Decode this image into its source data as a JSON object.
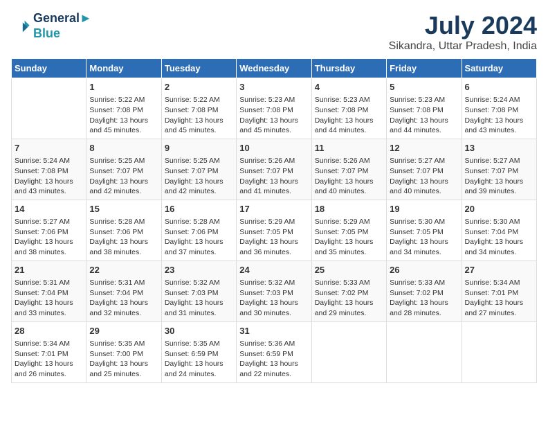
{
  "header": {
    "logo_line1": "General",
    "logo_line2": "Blue",
    "title": "July 2024",
    "subtitle": "Sikandra, Uttar Pradesh, India"
  },
  "weekdays": [
    "Sunday",
    "Monday",
    "Tuesday",
    "Wednesday",
    "Thursday",
    "Friday",
    "Saturday"
  ],
  "weeks": [
    [
      {
        "day": "",
        "content": ""
      },
      {
        "day": "1",
        "content": "Sunrise: 5:22 AM\nSunset: 7:08 PM\nDaylight: 13 hours\nand 45 minutes."
      },
      {
        "day": "2",
        "content": "Sunrise: 5:22 AM\nSunset: 7:08 PM\nDaylight: 13 hours\nand 45 minutes."
      },
      {
        "day": "3",
        "content": "Sunrise: 5:23 AM\nSunset: 7:08 PM\nDaylight: 13 hours\nand 45 minutes."
      },
      {
        "day": "4",
        "content": "Sunrise: 5:23 AM\nSunset: 7:08 PM\nDaylight: 13 hours\nand 44 minutes."
      },
      {
        "day": "5",
        "content": "Sunrise: 5:23 AM\nSunset: 7:08 PM\nDaylight: 13 hours\nand 44 minutes."
      },
      {
        "day": "6",
        "content": "Sunrise: 5:24 AM\nSunset: 7:08 PM\nDaylight: 13 hours\nand 43 minutes."
      }
    ],
    [
      {
        "day": "7",
        "content": "Sunrise: 5:24 AM\nSunset: 7:08 PM\nDaylight: 13 hours\nand 43 minutes."
      },
      {
        "day": "8",
        "content": "Sunrise: 5:25 AM\nSunset: 7:07 PM\nDaylight: 13 hours\nand 42 minutes."
      },
      {
        "day": "9",
        "content": "Sunrise: 5:25 AM\nSunset: 7:07 PM\nDaylight: 13 hours\nand 42 minutes."
      },
      {
        "day": "10",
        "content": "Sunrise: 5:26 AM\nSunset: 7:07 PM\nDaylight: 13 hours\nand 41 minutes."
      },
      {
        "day": "11",
        "content": "Sunrise: 5:26 AM\nSunset: 7:07 PM\nDaylight: 13 hours\nand 40 minutes."
      },
      {
        "day": "12",
        "content": "Sunrise: 5:27 AM\nSunset: 7:07 PM\nDaylight: 13 hours\nand 40 minutes."
      },
      {
        "day": "13",
        "content": "Sunrise: 5:27 AM\nSunset: 7:07 PM\nDaylight: 13 hours\nand 39 minutes."
      }
    ],
    [
      {
        "day": "14",
        "content": "Sunrise: 5:27 AM\nSunset: 7:06 PM\nDaylight: 13 hours\nand 38 minutes."
      },
      {
        "day": "15",
        "content": "Sunrise: 5:28 AM\nSunset: 7:06 PM\nDaylight: 13 hours\nand 38 minutes."
      },
      {
        "day": "16",
        "content": "Sunrise: 5:28 AM\nSunset: 7:06 PM\nDaylight: 13 hours\nand 37 minutes."
      },
      {
        "day": "17",
        "content": "Sunrise: 5:29 AM\nSunset: 7:05 PM\nDaylight: 13 hours\nand 36 minutes."
      },
      {
        "day": "18",
        "content": "Sunrise: 5:29 AM\nSunset: 7:05 PM\nDaylight: 13 hours\nand 35 minutes."
      },
      {
        "day": "19",
        "content": "Sunrise: 5:30 AM\nSunset: 7:05 PM\nDaylight: 13 hours\nand 34 minutes."
      },
      {
        "day": "20",
        "content": "Sunrise: 5:30 AM\nSunset: 7:04 PM\nDaylight: 13 hours\nand 34 minutes."
      }
    ],
    [
      {
        "day": "21",
        "content": "Sunrise: 5:31 AM\nSunset: 7:04 PM\nDaylight: 13 hours\nand 33 minutes."
      },
      {
        "day": "22",
        "content": "Sunrise: 5:31 AM\nSunset: 7:04 PM\nDaylight: 13 hours\nand 32 minutes."
      },
      {
        "day": "23",
        "content": "Sunrise: 5:32 AM\nSunset: 7:03 PM\nDaylight: 13 hours\nand 31 minutes."
      },
      {
        "day": "24",
        "content": "Sunrise: 5:32 AM\nSunset: 7:03 PM\nDaylight: 13 hours\nand 30 minutes."
      },
      {
        "day": "25",
        "content": "Sunrise: 5:33 AM\nSunset: 7:02 PM\nDaylight: 13 hours\nand 29 minutes."
      },
      {
        "day": "26",
        "content": "Sunrise: 5:33 AM\nSunset: 7:02 PM\nDaylight: 13 hours\nand 28 minutes."
      },
      {
        "day": "27",
        "content": "Sunrise: 5:34 AM\nSunset: 7:01 PM\nDaylight: 13 hours\nand 27 minutes."
      }
    ],
    [
      {
        "day": "28",
        "content": "Sunrise: 5:34 AM\nSunset: 7:01 PM\nDaylight: 13 hours\nand 26 minutes."
      },
      {
        "day": "29",
        "content": "Sunrise: 5:35 AM\nSunset: 7:00 PM\nDaylight: 13 hours\nand 25 minutes."
      },
      {
        "day": "30",
        "content": "Sunrise: 5:35 AM\nSunset: 6:59 PM\nDaylight: 13 hours\nand 24 minutes."
      },
      {
        "day": "31",
        "content": "Sunrise: 5:36 AM\nSunset: 6:59 PM\nDaylight: 13 hours\nand 22 minutes."
      },
      {
        "day": "",
        "content": ""
      },
      {
        "day": "",
        "content": ""
      },
      {
        "day": "",
        "content": ""
      }
    ]
  ]
}
